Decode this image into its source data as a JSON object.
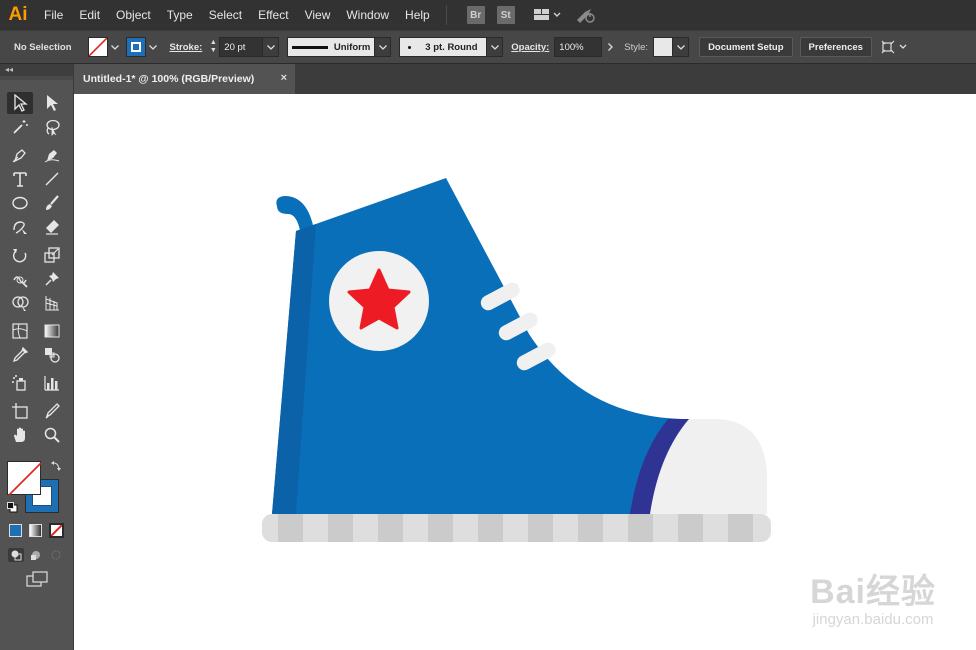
{
  "app": {
    "logo": "Ai"
  },
  "menu": [
    "File",
    "Edit",
    "Object",
    "Type",
    "Select",
    "Effect",
    "View",
    "Window",
    "Help"
  ],
  "bridge_badges": [
    "Br",
    "St"
  ],
  "control": {
    "selection": "No Selection",
    "stroke_label": "Stroke:",
    "stroke_weight": "20 pt",
    "profile": "Uniform",
    "brush": "3 pt. Round",
    "opacity_label": "Opacity:",
    "opacity_value": "100%",
    "style_label": "Style:",
    "document_setup": "Document Setup",
    "preferences": "Preferences"
  },
  "document": {
    "tab_title": "Untitled-1* @ 100% (RGB/Preview)",
    "close_glyph": "×"
  },
  "toolbar": {
    "collapse_glyph": "◂◂"
  },
  "watermark": {
    "main": "Bai经验",
    "sub": "jingyan.baidu.com"
  },
  "colors": {
    "shoe_blue": "#0a6fb9",
    "shoe_dark_blue": "#0c62a8",
    "toe_band": "#2f3394",
    "toe_cap": "#f0f0f0",
    "star_red": "#ed1c24",
    "sole_light": "#dedede",
    "sole_dark": "#cbcbcb",
    "stroke_swatch": "#1f6fb5",
    "logo_orange": "#ff9a00"
  }
}
